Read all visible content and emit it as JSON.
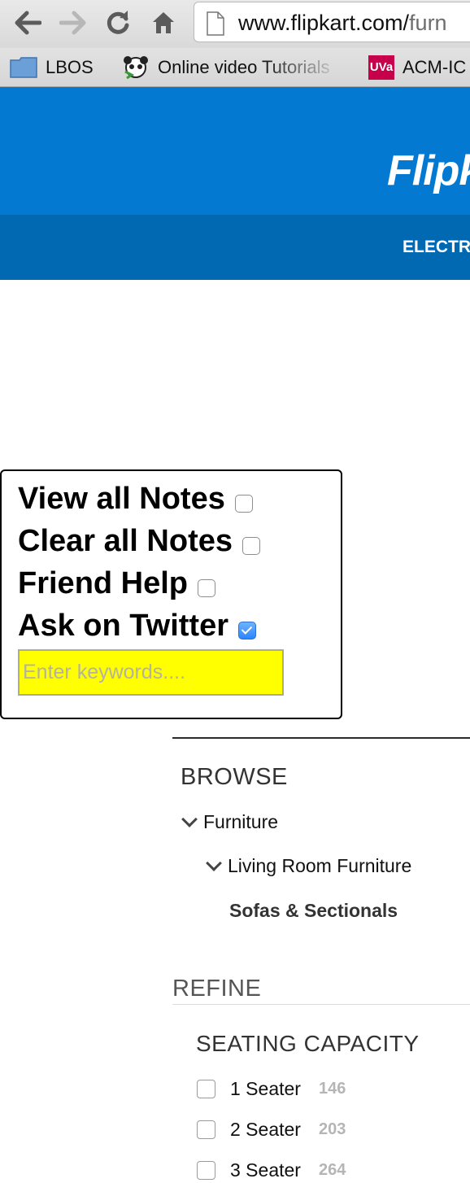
{
  "browser": {
    "url_main": "www.flipkart.com/",
    "url_rest": "furn",
    "bookmarks": [
      {
        "label": "LBOS",
        "icon": "folder-icon"
      },
      {
        "label": "Online video Tutorials",
        "icon": "panda-icon"
      },
      {
        "label": "ACM-IC",
        "badge": "UVa"
      }
    ]
  },
  "header": {
    "logo": "Flipk",
    "nav_item": "ELECTR"
  },
  "notes_widget": {
    "options": [
      {
        "label": "View all Notes",
        "checked": false
      },
      {
        "label": "Clear all Notes",
        "checked": false
      },
      {
        "label": "Friend Help",
        "checked": false
      },
      {
        "label": "Ask on Twitter",
        "checked": true
      }
    ],
    "keyword_placeholder": "Enter keywords....",
    "input_bg": "#ffff00"
  },
  "browse": {
    "title": "BROWSE",
    "level1": "Furniture",
    "level2": "Living Room Furniture",
    "current": "Sofas & Sectionals"
  },
  "refine": {
    "title": "REFINE",
    "facet_title": "SEATING CAPACITY",
    "options": [
      {
        "label": "1 Seater",
        "count": "146"
      },
      {
        "label": "2 Seater",
        "count": "203"
      },
      {
        "label": "3 Seater",
        "count": "264"
      }
    ]
  },
  "colors": {
    "header_blue": "#0479d2",
    "nav_blue": "#0168b2"
  }
}
